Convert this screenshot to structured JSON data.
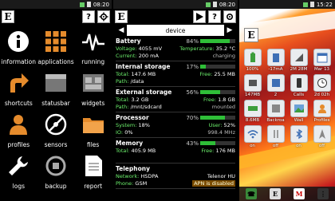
{
  "panel1": {
    "status": {
      "time": "08:20"
    },
    "logo_letter": "E",
    "apps": [
      {
        "label": "information",
        "icon": "info-icon"
      },
      {
        "label": "applications",
        "icon": "apps-grid-icon"
      },
      {
        "label": "running",
        "icon": "pulse-icon"
      },
      {
        "label": "shortcuts",
        "icon": "shortcut-arrow-icon"
      },
      {
        "label": "statusbar",
        "icon": "statusbar-icon"
      },
      {
        "label": "widgets",
        "icon": "widgets-icon"
      },
      {
        "label": "profiles",
        "icon": "profile-icon"
      },
      {
        "label": "sensors",
        "icon": "sensors-icon"
      },
      {
        "label": "files",
        "icon": "folder-icon"
      },
      {
        "label": "logs",
        "icon": "wrench-icon"
      },
      {
        "label": "backup",
        "icon": "backup-icon"
      },
      {
        "label": "report",
        "icon": "report-icon"
      }
    ]
  },
  "panel2": {
    "status": {
      "time": "08:20"
    },
    "logo_letter": "E",
    "nav_title": "device",
    "rows": [
      {
        "title": "Battery",
        "pct": "84%",
        "fill": 0.84,
        "l1": [
          "Voltage:",
          "4055 mV"
        ],
        "r1": [
          "Temperature:",
          "35.2 °C"
        ],
        "l2": [
          "Current:",
          "200 mA"
        ],
        "r2": [
          "",
          "charging"
        ]
      },
      {
        "title": "Internal storage",
        "pct": "17%",
        "fill": 0.17,
        "l1": [
          "Total:",
          "147.6 MB"
        ],
        "r1": [
          "Free:",
          "25.5 MB"
        ],
        "l2": [
          "Path:",
          "/data"
        ],
        "r2": [
          "",
          ""
        ]
      },
      {
        "title": "External storage",
        "pct": "56%",
        "fill": 0.56,
        "l1": [
          "Total:",
          "3.2 GB"
        ],
        "r1": [
          "Free:",
          "1.8 GB"
        ],
        "l2": [
          "Path:",
          "/mnt/sdcard"
        ],
        "r2": [
          "",
          "mounted"
        ]
      },
      {
        "title": "Processor",
        "pct": "70%",
        "fill": 0.7,
        "l1": [
          "System:",
          "18%"
        ],
        "r1": [
          "User:",
          "52%"
        ],
        "l2": [
          "IO:",
          "0%"
        ],
        "r2": [
          "",
          "998.4 MHz"
        ]
      },
      {
        "title": "Memory",
        "pct": "43%",
        "fill": 0.43,
        "l1": [
          "Total:",
          "405.9 MB"
        ],
        "r1": [
          "Free:",
          "176 MB"
        ],
        "l2": [
          "",
          ""
        ],
        "r2": [
          "",
          ""
        ]
      },
      {
        "title": "Telephony",
        "pct": "",
        "fill": 0,
        "l1": [
          "Network:",
          "HSDPA"
        ],
        "r1": [
          "",
          "Telenor HU"
        ],
        "l2": [
          "Phone:",
          "GSM"
        ],
        "r2": [
          "",
          "disconnected"
        ],
        "extra": "APN is disabled"
      }
    ]
  },
  "panel3": {
    "status": {
      "time": "15:22"
    },
    "logo_letter": "E",
    "tiles": [
      {
        "label": "100%",
        "icon": "battery-icon"
      },
      {
        "label": "-17mA",
        "icon": "current-icon"
      },
      {
        "label": "2M 28M",
        "icon": "network-icon"
      },
      {
        "label": "Mar 13",
        "icon": "calendar-icon"
      },
      {
        "label": "147MB",
        "icon": "storage-icon"
      },
      {
        "label": "2",
        "icon": "processes-icon"
      },
      {
        "label": "Calls",
        "icon": "phone-icon"
      },
      {
        "label": "2d 02h",
        "icon": "clock-icon"
      },
      {
        "label": "8.6MB",
        "icon": "memory-icon"
      },
      {
        "label": "Backroa",
        "icon": "backup-tile-icon"
      },
      {
        "label": "Wall",
        "icon": "wallpaper-icon"
      },
      {
        "label": "Profiles",
        "icon": "profiles-tile-icon"
      },
      {
        "label": "on",
        "icon": "wifi-icon"
      },
      {
        "label": "off",
        "icon": "data-icon"
      },
      {
        "label": "on",
        "icon": "bluetooth-icon"
      },
      {
        "label": "off",
        "icon": "gps-icon"
      }
    ]
  }
}
